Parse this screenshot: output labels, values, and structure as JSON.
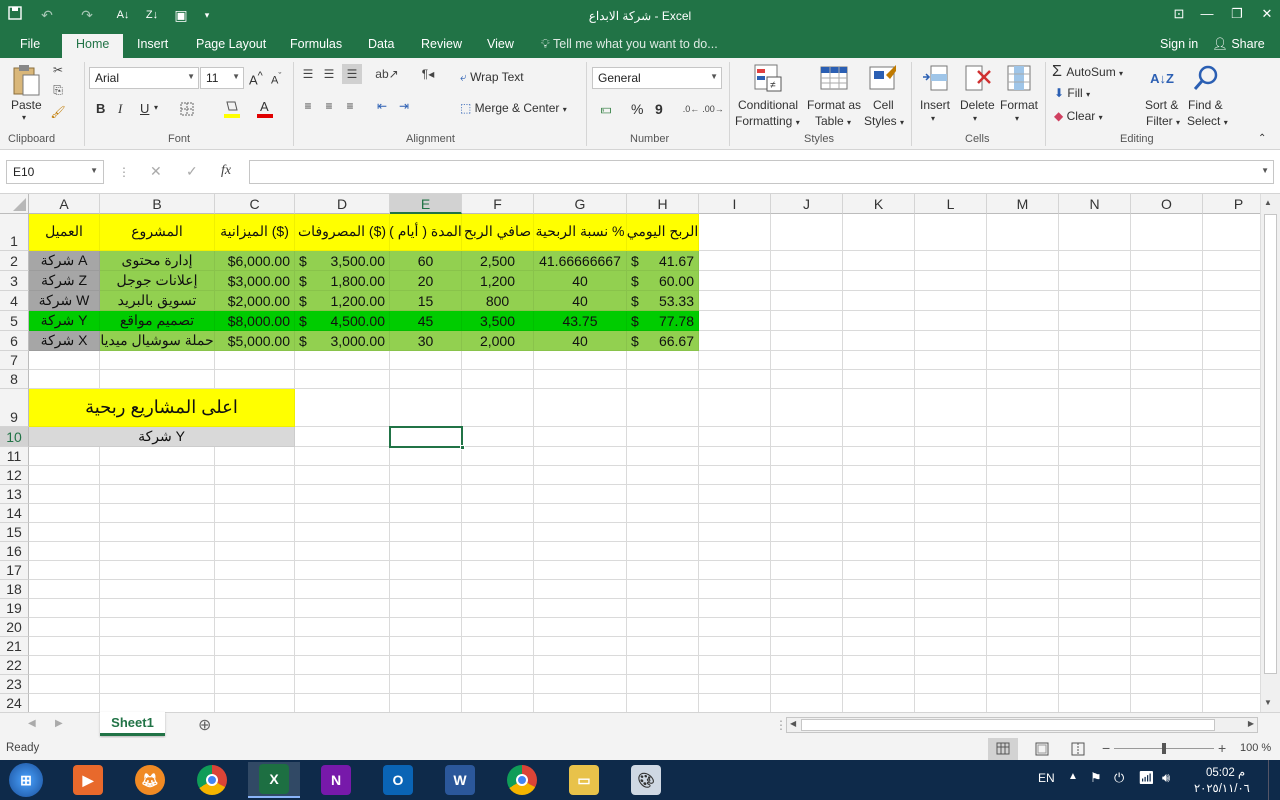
{
  "window": {
    "title": "شركة الابداع - Excel"
  },
  "tabs": [
    "File",
    "Home",
    "Insert",
    "Page Layout",
    "Formulas",
    "Data",
    "Review",
    "View"
  ],
  "active_tab": "Home",
  "tell_me": "Tell me what you want to do...",
  "signin": "Sign in",
  "share": "Share",
  "ribbon": {
    "clipboard": {
      "paste": "Paste",
      "label": "Clipboard"
    },
    "font": {
      "name": "Arial",
      "size": "11",
      "label": "Font",
      "bold": "B",
      "italic": "I",
      "underline": "U"
    },
    "alignment": {
      "wrap": "Wrap Text",
      "merge": "Merge & Center",
      "label": "Alignment"
    },
    "number": {
      "format": "General",
      "label": "Number",
      "percent": "%",
      "comma": "9"
    },
    "styles": {
      "cond1": "Conditional",
      "cond2": "Formatting",
      "fmt1": "Format as",
      "fmt2": "Table",
      "cell1": "Cell",
      "cell2": "Styles",
      "label": "Styles"
    },
    "cells": {
      "insert": "Insert",
      "delete": "Delete",
      "format": "Format",
      "label": "Cells"
    },
    "editing": {
      "autosum": "AutoSum",
      "fill": "Fill",
      "clear": "Clear",
      "sort1": "Sort &",
      "sort2": "Filter",
      "find1": "Find &",
      "find2": "Select",
      "label": "Editing"
    }
  },
  "formula_bar": {
    "name_box": "E10",
    "fx": "fx",
    "value": ""
  },
  "columns": [
    "A",
    "B",
    "C",
    "D",
    "E",
    "F",
    "G",
    "H",
    "I",
    "J",
    "K",
    "L",
    "M",
    "N",
    "O",
    "P"
  ],
  "selected_column": "E",
  "rows": [
    "1",
    "2",
    "3",
    "4",
    "5",
    "6",
    "7",
    "8",
    "9",
    "10",
    "11",
    "12",
    "13",
    "14",
    "15",
    "16",
    "17",
    "18",
    "19",
    "20",
    "21",
    "22",
    "23",
    "24"
  ],
  "selected_row": "10",
  "sheet": {
    "headers": [
      "العميل",
      "المشروع",
      "الميزانية ($)",
      "المصروفات ($)",
      "المدة ( أيام )",
      "صافي الربح",
      "نسبة الربحية %",
      "الربح اليومي"
    ],
    "data": [
      {
        "client": "شركة A",
        "project": "إدارة محتوى",
        "budget": "$6,000.00",
        "exp_sym": "$",
        "expenses": "3,500.00",
        "days": "60",
        "net": "2,500",
        "margin": "41.66666667",
        "daily_sym": "$",
        "daily": "41.67"
      },
      {
        "client": "شركة Z",
        "project": "إعلانات جوجل",
        "budget": "$3,000.00",
        "exp_sym": "$",
        "expenses": "1,800.00",
        "days": "20",
        "net": "1,200",
        "margin": "40",
        "daily_sym": "$",
        "daily": "60.00"
      },
      {
        "client": "شركة W",
        "project": "تسويق بالبريد",
        "budget": "$2,000.00",
        "exp_sym": "$",
        "expenses": "1,200.00",
        "days": "15",
        "net": "800",
        "margin": "40",
        "daily_sym": "$",
        "daily": "53.33"
      },
      {
        "client": "شركة Y",
        "project": "تصميم مواقع",
        "budget": "$8,000.00",
        "exp_sym": "$",
        "expenses": "4,500.00",
        "days": "45",
        "net": "3,500",
        "margin": "43.75",
        "daily_sym": "$",
        "daily": "77.78"
      },
      {
        "client": "شركة X",
        "project": "حملة سوشيال ميديا",
        "budget": "$5,000.00",
        "exp_sym": "$",
        "expenses": "3,000.00",
        "days": "30",
        "net": "2,000",
        "margin": "40",
        "daily_sym": "$",
        "daily": "66.67"
      }
    ],
    "summary_title": "اعلى المشاريع ربحية",
    "summary_value": "شركة Y"
  },
  "colors": {
    "green_dark": "#217346",
    "header_yellow": "#ffff00",
    "row_green": "#92d050",
    "row_highlight": "#00cc00",
    "client_gray": "#a6a6a6",
    "summary_gray": "#d9d9d9"
  },
  "sheet_tab": "Sheet1",
  "status": {
    "ready": "Ready",
    "zoom": "100 %"
  },
  "taskbar": {
    "lang": "EN",
    "time": "05:02 م",
    "date": "٢٠٢٥/١١/٠٦"
  }
}
